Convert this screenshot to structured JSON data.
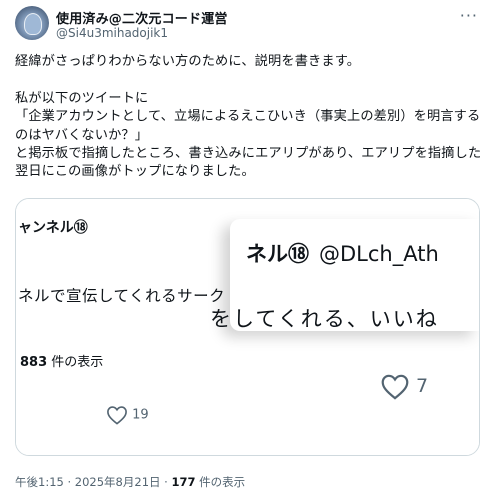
{
  "user": {
    "display_name": "使用済み@二次元コード運営",
    "handle": "@Si4u3mihadojik1"
  },
  "more_label": "···",
  "tweet_text": "経緯がさっぱりわからない方のために、説明を書きます。\n\n私が以下のツイートに\n「企業アカウントとして、立場によるえこひいき（事実上の差別）を明言するのはヤバくないか？」\nと掲示板で指摘したところ、書き込みにエアリプがあり、エアリプを指摘した翌日にこの画像がトップになりました。",
  "media": {
    "left": {
      "channel_name": "ャンネル⑱",
      "promo_text": "ネルで宣伝してくれるサーク",
      "views_count": "883",
      "views_suffix": " 件の表示",
      "likes_count": "19"
    },
    "right": {
      "channel_name": "ネル⑱",
      "channel_handle": "@DLch_Ath",
      "promo_text": "をしてくれる、いいね",
      "likes_count": "7"
    }
  },
  "footer": {
    "timestamp": "午後1:15 · 2025年8月21日 · ",
    "views_count": "177",
    "views_suffix": " 件の表示"
  }
}
